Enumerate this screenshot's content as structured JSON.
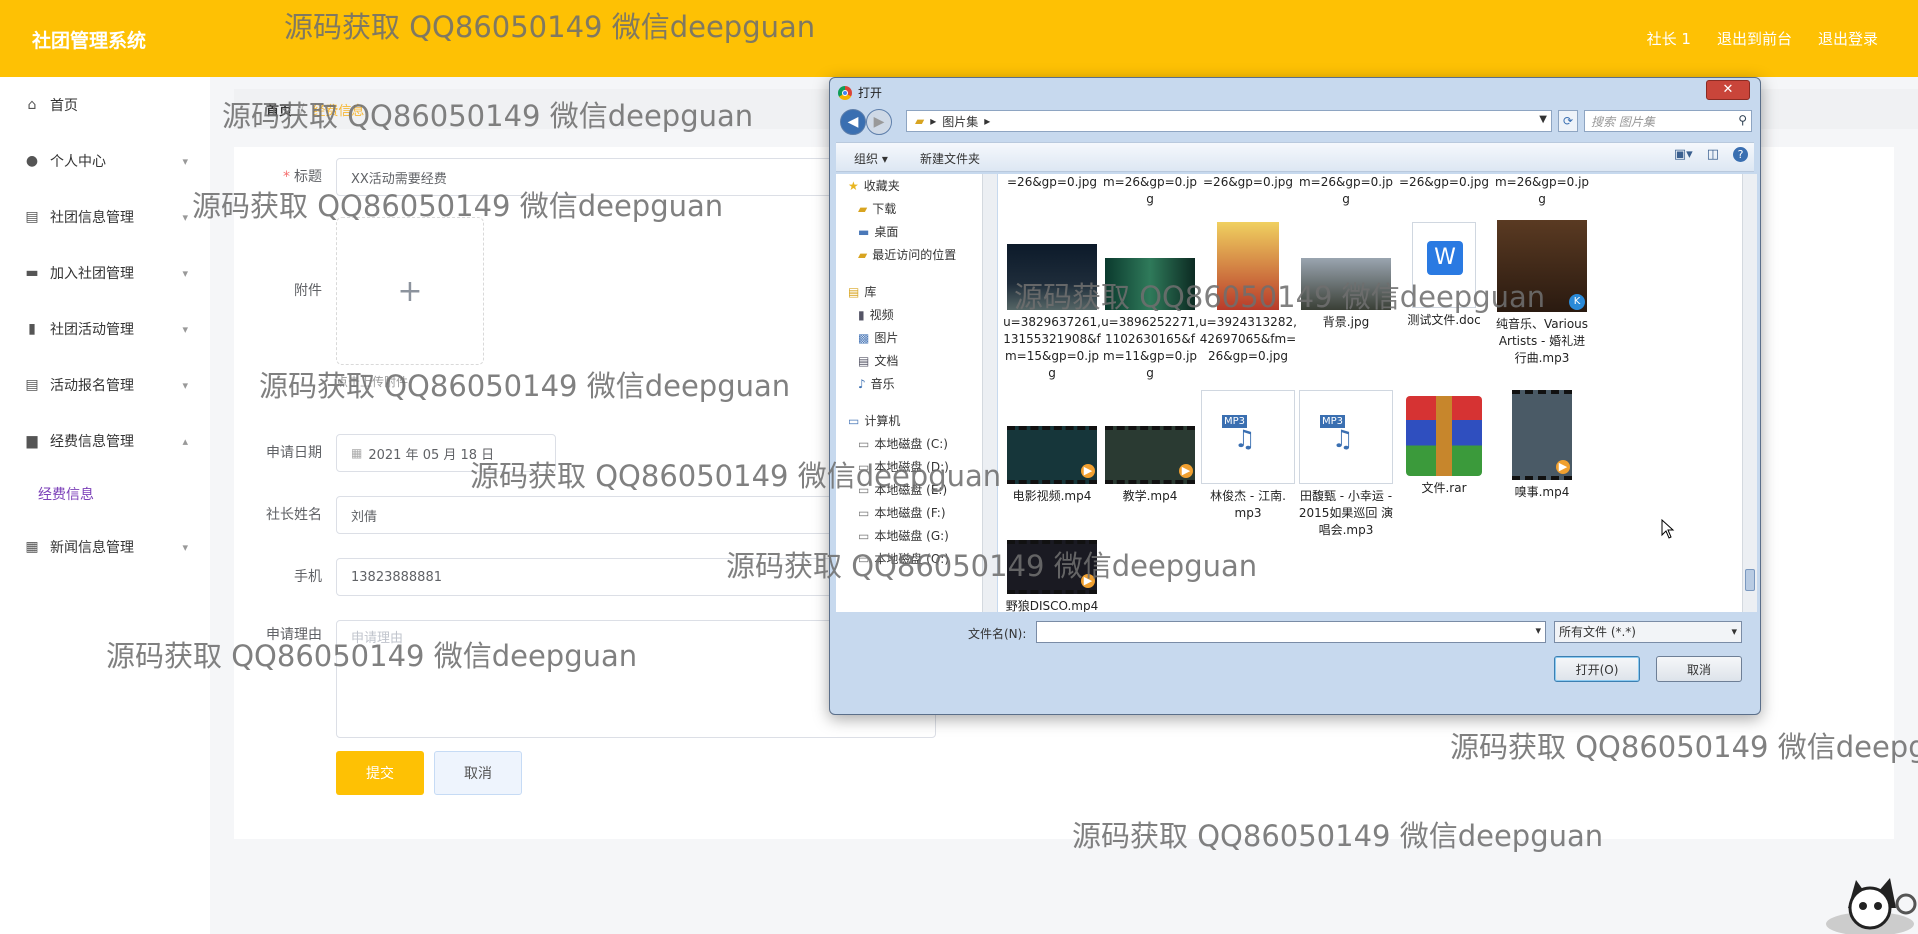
{
  "app": {
    "title": "社团管理系统"
  },
  "header": {
    "user": "社长 1",
    "to_front": "退出到前台",
    "logout": "退出登录"
  },
  "sidebar": {
    "items": [
      {
        "label": "首页",
        "icon": "home-icon",
        "chevron": ""
      },
      {
        "label": "个人中心",
        "icon": "user-icon",
        "chevron": "▾"
      },
      {
        "label": "社团信息管理",
        "icon": "clipboard-icon",
        "chevron": "▾"
      },
      {
        "label": "加入社团管理",
        "icon": "book-icon",
        "chevron": "▾"
      },
      {
        "label": "社团活动管理",
        "icon": "bar-chart-icon",
        "chevron": "▾"
      },
      {
        "label": "活动报名管理",
        "icon": "clipboard-icon",
        "chevron": "▾"
      },
      {
        "label": "经费信息管理",
        "icon": "briefcase-icon",
        "chevron": "▴"
      },
      {
        "label": "新闻信息管理",
        "icon": "grid-icon",
        "chevron": "▾"
      }
    ],
    "sub_item": "经费信息"
  },
  "breadcrumb": {
    "home": "首页",
    "separator": "/",
    "current": "经费信息"
  },
  "form": {
    "title_label": "标题",
    "title_value": "XX活动需要经费",
    "attachment_label": "附件",
    "upload_tip": "点击上传附件",
    "date_label": "申请日期",
    "date_value": "2021 年 05 月 18 日",
    "leader_label": "社长姓名",
    "leader_value": "刘倩",
    "phone_label": "手机",
    "phone_value": "13823888881",
    "reason_label": "申请理由",
    "reason_placeholder": "申请理由",
    "submit": "提交",
    "cancel": "取消"
  },
  "dialog": {
    "title": "打开",
    "close": "✕",
    "path": "图片集",
    "search_placeholder": "搜索 图片集",
    "organize": "组织 ▾",
    "new_folder": "新建文件夹",
    "tree": [
      {
        "label": "收藏夹",
        "type": "star"
      },
      {
        "label": "下载",
        "type": "folder"
      },
      {
        "label": "桌面",
        "type": "desktop"
      },
      {
        "label": "最近访问的位置",
        "type": "folder"
      },
      {
        "label": "",
        "type": "gap"
      },
      {
        "label": "库",
        "type": "library"
      },
      {
        "label": "视频",
        "type": "video"
      },
      {
        "label": "图片",
        "type": "image"
      },
      {
        "label": "文档",
        "type": "doc"
      },
      {
        "label": "音乐",
        "type": "music"
      },
      {
        "label": "",
        "type": "gap"
      },
      {
        "label": "计算机",
        "type": "computer"
      },
      {
        "label": "本地磁盘 (C:)",
        "type": "disk"
      },
      {
        "label": "本地磁盘 (D:)",
        "type": "disk"
      },
      {
        "label": "本地磁盘 (E:)",
        "type": "disk"
      },
      {
        "label": "本地磁盘 (F:)",
        "type": "disk"
      },
      {
        "label": "本地磁盘 (G:)",
        "type": "disk"
      },
      {
        "label": "本地磁盘 (Q:)",
        "type": "disk"
      }
    ],
    "top_row": [
      "=26&gp=0.jpg",
      "m=26&gp=0.jp g",
      "=26&gp=0.jpg",
      "m=26&gp=0.jp g",
      "=26&gp=0.jpg",
      "m=26&gp=0.jp g"
    ],
    "files_row1": [
      "u=3829637261, 13155321908&f m=15&gp=0.jp g",
      "u=3896252271, 1102630165&f m=11&gp=0.jp g",
      "u=3924313282, 42697065&fm= 26&gp=0.jpg",
      "背景.jpg",
      "测试文件.doc",
      "纯音乐、Various Artists - 婚礼进 行曲.mp3"
    ],
    "files_row2": [
      "电影视频.mp4",
      "教学.mp4",
      "林俊杰 - 江南. mp3",
      "田馥甄 - 小幸运 - 2015如果巡回 演唱会.mp3",
      "文件.rar",
      "嗅事.mp4"
    ],
    "files_row3": [
      "野狼DISCO.mp4"
    ],
    "mp3_badge": "MP3",
    "filename_label": "文件名(N):",
    "filetype": "所有文件 (*.*)",
    "open_button": "打开(O)",
    "cancel_button": "取消"
  },
  "watermark": "源码获取 QQ86050149 微信deepguan",
  "watermark_cut": "源码获取 QQ86050149 微信deepg",
  "colors": {
    "accent": "#fec104",
    "purple": "#7b3fb8"
  }
}
